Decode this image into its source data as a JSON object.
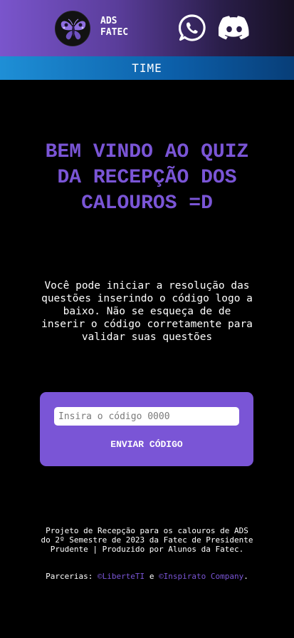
{
  "header": {
    "brand_line1": "ADS",
    "brand_line2": "FATEC",
    "logo_icon": "moth-logo",
    "whatsapp_icon": "whatsapp-icon",
    "discord_icon": "discord-icon",
    "gradient_start": "#7a55cc",
    "gradient_end": "#161022"
  },
  "nav": {
    "time_label": "TIME",
    "bar_color": "#0c5ea8"
  },
  "main": {
    "title": "BEM VINDO AO QUIZ DA RECEPÇÃO DOS CALOUROS =D",
    "intro": "Você pode iniciar a resolução das questões inserindo o código logo a baixo. Não se esqueça de de inserir o código corretamente para validar suas questões",
    "accent_color": "#7a55d6"
  },
  "code_form": {
    "placeholder": "Insira o código 0000",
    "value": "",
    "submit_label": "ENVIAR CÓDIGO"
  },
  "footer": {
    "text": "Projeto de Recepção para os calouros de ADS do 2º Semestre de 2023 da Fatec de Presidente Prudente | Produzido por Alunos da Fatec.",
    "partners_prefix": "Parcerias:",
    "partner1": "©LiberteTI",
    "conjunction": "e",
    "partner2": "©Inspirato Company",
    "end": "."
  }
}
